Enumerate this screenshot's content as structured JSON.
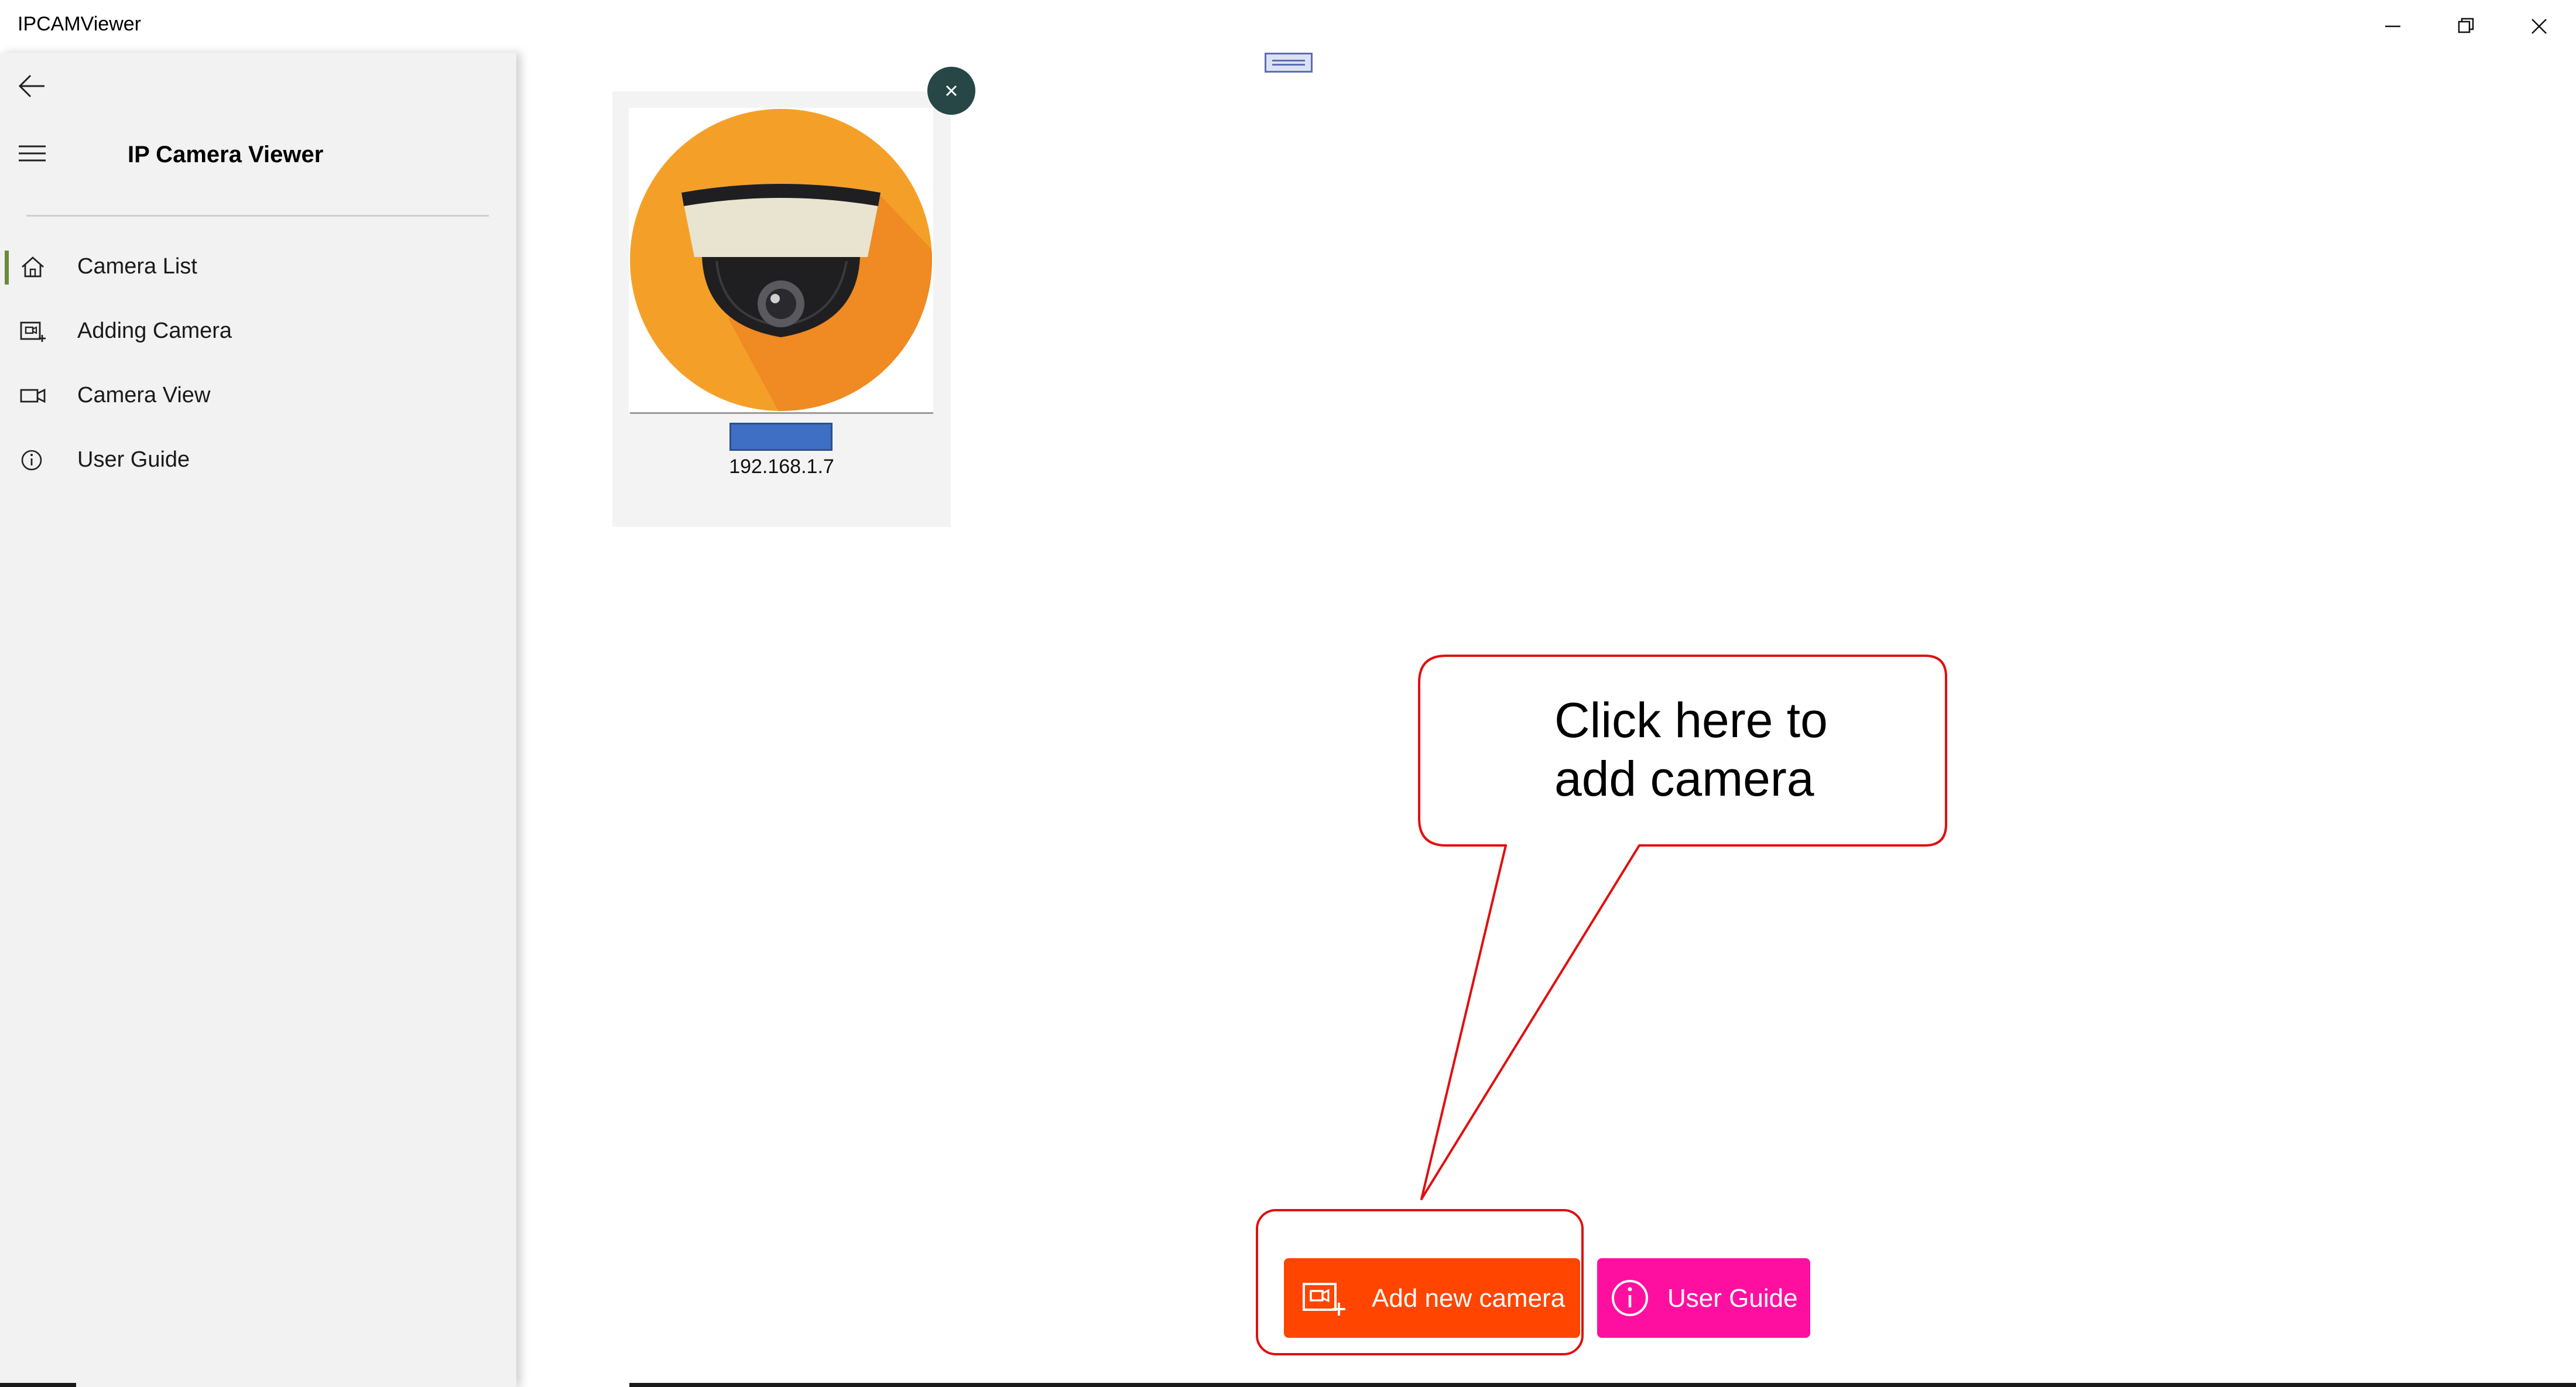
{
  "window": {
    "title": "IPCAMViewer",
    "controls": [
      "minimize-icon",
      "restore-icon",
      "close-icon"
    ]
  },
  "sidebar": {
    "title": "IP Camera Viewer",
    "items": [
      {
        "label": "Camera List",
        "icon": "home-icon",
        "selected": true
      },
      {
        "label": "Adding Camera",
        "icon": "add-camera-icon",
        "selected": false
      },
      {
        "label": "Camera View",
        "icon": "video-camera-icon",
        "selected": false
      },
      {
        "label": "User Guide",
        "icon": "info-icon",
        "selected": false
      }
    ]
  },
  "camera_list": [
    {
      "ip": "192.168.1.7",
      "name_bar_color": "#3f6fc4",
      "thumbnail": "dome-camera-icon"
    }
  ],
  "callout": {
    "text_line1": "Click here to",
    "text_line2": "add camera",
    "color": "#e01010"
  },
  "actions": {
    "add_label": "Add new camera",
    "add_color": "#ff4500",
    "guide_label": "User Guide",
    "guide_color": "#ff0fa0"
  }
}
